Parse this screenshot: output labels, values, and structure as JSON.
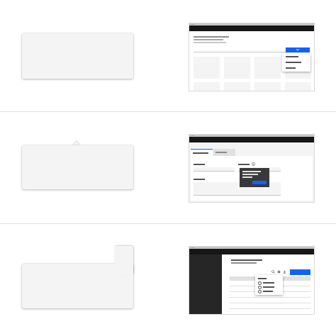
{
  "rows": [
    {
      "id": "dropdown-example",
      "placeholder_shape": "plain-card",
      "preview": {
        "has_header_lines": true,
        "button_color": "#0f62fe",
        "menu_item_count": 3,
        "tile_count": 4
      }
    },
    {
      "id": "tooltip-example",
      "placeholder_shape": "card-with-caret",
      "preview": {
        "tab_count": 2,
        "info_icon": "info-icon",
        "button_color": "#0f62fe"
      }
    },
    {
      "id": "overflow-menu-example",
      "placeholder_shape": "card-with-tab",
      "preview": {
        "sidebar_color": "#262626",
        "toolbar_icons": [
          "search-icon",
          "settings-icon",
          "download-icon"
        ],
        "button_color": "#0f62fe",
        "radio_option_count": 3
      }
    }
  ],
  "colors": {
    "divider": "#e0e0e0",
    "card": "#f4f4f4",
    "topbar": "#161616",
    "accent": "#0f62fe",
    "tooltip": "#393939"
  }
}
